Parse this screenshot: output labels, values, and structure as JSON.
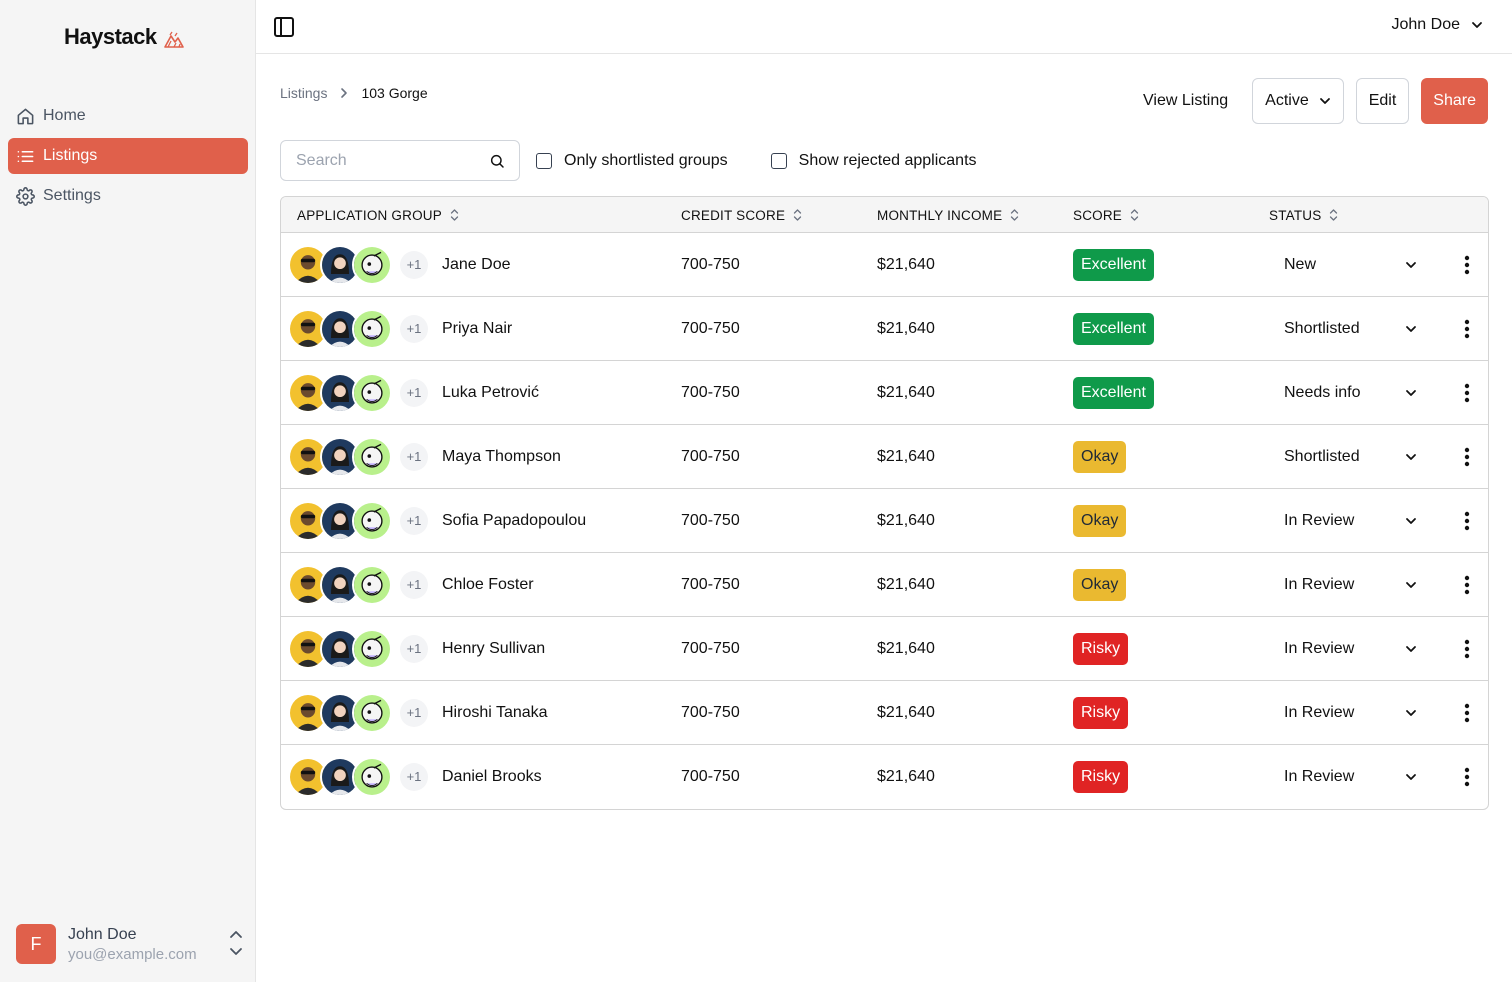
{
  "app": {
    "name": "Haystack",
    "brand_color": "#e0604b"
  },
  "sidebar": {
    "items": [
      {
        "label": "Home",
        "icon": "home-icon",
        "active": false
      },
      {
        "label": "Listings",
        "icon": "list-icon",
        "active": true
      },
      {
        "label": "Settings",
        "icon": "gear-icon",
        "active": false
      }
    ],
    "user": {
      "initial": "F",
      "name": "John Doe",
      "email": "you@example.com"
    }
  },
  "topbar": {
    "account_name": "John Doe"
  },
  "breadcrumb": {
    "parent": "Listings",
    "current": "103 Gorge"
  },
  "actions": {
    "view_listing": "View Listing",
    "status_value": "Active",
    "edit": "Edit",
    "share": "Share"
  },
  "filters": {
    "search_placeholder": "Search",
    "only_shortlisted": "Only shortlisted groups",
    "show_rejected": "Show rejected applicants"
  },
  "table": {
    "columns": [
      "APPLICATION GROUP",
      "CREDIT SCORE",
      "MONTHLY INCOME",
      "SCORE",
      "STATUS"
    ],
    "rows": [
      {
        "extra": "+1",
        "name": "Jane Doe",
        "credit": "700-750",
        "income": "$21,640",
        "score": "Excellent",
        "status": "New"
      },
      {
        "extra": "+1",
        "name": "Priya Nair",
        "credit": "700-750",
        "income": "$21,640",
        "score": "Excellent",
        "status": "Shortlisted"
      },
      {
        "extra": "+1",
        "name": "Luka Petrović",
        "credit": "700-750",
        "income": "$21,640",
        "score": "Excellent",
        "status": "Needs info"
      },
      {
        "extra": "+1",
        "name": "Maya Thompson",
        "credit": "700-750",
        "income": "$21,640",
        "score": "Okay",
        "status": "Shortlisted"
      },
      {
        "extra": "+1",
        "name": "Sofia Papadopoulou",
        "credit": "700-750",
        "income": "$21,640",
        "score": "Okay",
        "status": "In Review"
      },
      {
        "extra": "+1",
        "name": "Chloe Foster",
        "credit": "700-750",
        "income": "$21,640",
        "score": "Okay",
        "status": "In Review"
      },
      {
        "extra": "+1",
        "name": "Henry Sullivan",
        "credit": "700-750",
        "income": "$21,640",
        "score": "Risky",
        "status": "In Review"
      },
      {
        "extra": "+1",
        "name": "Hiroshi Tanaka",
        "credit": "700-750",
        "income": "$21,640",
        "score": "Risky",
        "status": "In Review"
      },
      {
        "extra": "+1",
        "name": "Daniel Brooks",
        "credit": "700-750",
        "income": "$21,640",
        "score": "Risky",
        "status": "In Review"
      }
    ]
  },
  "score_colors": {
    "Excellent": "#0f9a4a",
    "Okay": "#eab930",
    "Risky": "#e02424"
  }
}
